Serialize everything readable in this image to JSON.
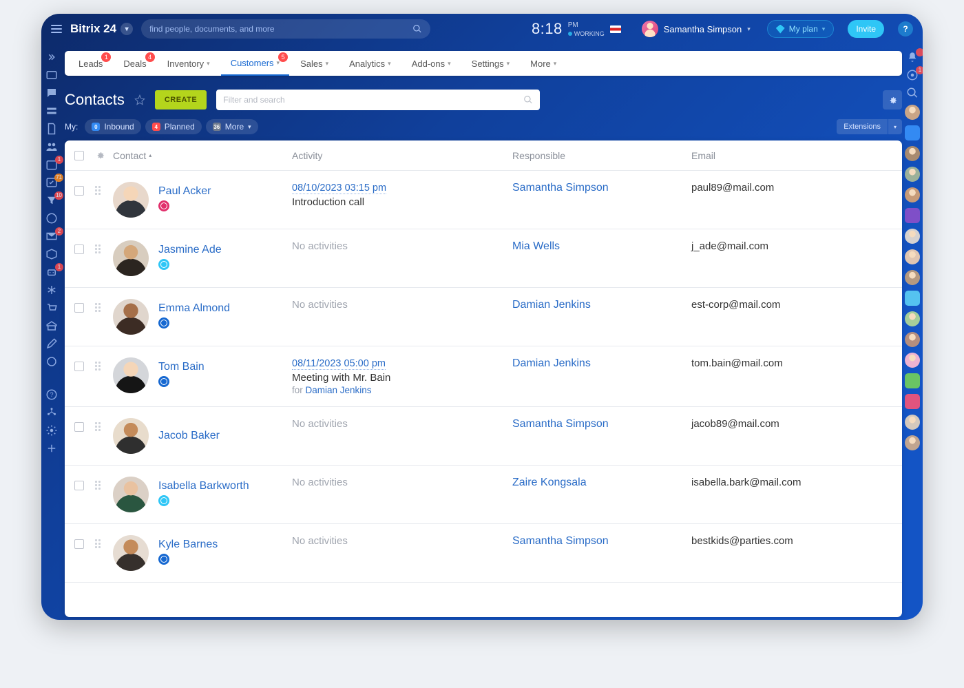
{
  "brand": "Bitrix 24",
  "search_placeholder": "find people, documents, and more",
  "clock": {
    "time": "8:18",
    "ampm": "PM",
    "status": "WORKING"
  },
  "user_name": "Samantha Simpson",
  "plan_label": "My plan",
  "invite_label": "Invite",
  "menu": [
    {
      "label": "Leads",
      "badge": "1"
    },
    {
      "label": "Deals",
      "badge": "4"
    },
    {
      "label": "Inventory"
    },
    {
      "label": "Customers",
      "badge": "5",
      "active": true
    },
    {
      "label": "Sales"
    },
    {
      "label": "Analytics"
    },
    {
      "label": "Add-ons"
    },
    {
      "label": "Settings"
    },
    {
      "label": "More"
    }
  ],
  "page_title": "Contacts",
  "create_label": "CREATE",
  "filter_placeholder": "Filter and search",
  "mybar": {
    "label": "My:",
    "chips": [
      {
        "c": "0",
        "color": "#338af3",
        "label": "Inbound"
      },
      {
        "c": "4",
        "color": "#ff4c4c",
        "label": "Planned"
      },
      {
        "c": "36",
        "color": "#6f7b8e",
        "label": "More"
      }
    ],
    "ext": "Extensions"
  },
  "columns": {
    "contact": "Contact",
    "activity": "Activity",
    "responsible": "Responsible",
    "email": "Email"
  },
  "rows": [
    {
      "photo": "a1",
      "name": "Paul Acker",
      "badge": "#e1306c",
      "date": "08/10/2023 03:15 pm",
      "desc": "Introduction call",
      "resp": "Samantha Simpson",
      "email": "paul89@mail.com"
    },
    {
      "photo": "a2",
      "name": "Jasmine Ade",
      "badge": "#2fc6f6",
      "noact": "No activities",
      "resp": "Mia Wells",
      "email": "j_ade@mail.com"
    },
    {
      "photo": "a3",
      "name": "Emma Almond",
      "badge": "#1668d1",
      "noact": "No activities",
      "resp": "Damian Jenkins",
      "email": "est-corp@mail.com"
    },
    {
      "photo": "a4",
      "name": "Tom Bain",
      "badge": "#1668d1",
      "date": "08/11/2023 05:00 pm",
      "desc": "Meeting with Mr. Bain",
      "for_label": "for",
      "for_person": "Damian Jenkins",
      "resp": "Damian Jenkins",
      "email": "tom.bain@mail.com"
    },
    {
      "photo": "a5",
      "name": "Jacob Baker",
      "noact": "No activities",
      "resp": "Samantha Simpson",
      "email": "jacob89@mail.com"
    },
    {
      "photo": "a6",
      "name": "Isabella Barkworth",
      "badge": "#2fc6f6",
      "noact": "No activities",
      "resp": "Zaire Kongsala",
      "email": "isabella.bark@mail.com"
    },
    {
      "photo": "a7",
      "name": "Kyle Barnes",
      "badge": "#1668d1",
      "noact": "No activities",
      "resp": "Samantha Simpson",
      "email": "bestkids@parties.com"
    }
  ],
  "left_rail": [
    {
      "name": "arrows-icon"
    },
    {
      "name": "window-icon"
    },
    {
      "name": "chat-icon"
    },
    {
      "name": "tray-icon"
    },
    {
      "name": "doc-icon"
    },
    {
      "name": "team-icon"
    },
    {
      "name": "calendar-icon",
      "badge": "1",
      "color": "#ff4c4c"
    },
    {
      "name": "tasks-icon",
      "badge": "71",
      "color": "#ff8c1a"
    },
    {
      "name": "filter-icon",
      "badge": "10",
      "color": "#ff4c4c"
    },
    {
      "name": "gauge-icon"
    },
    {
      "name": "mail-icon",
      "badge": "2",
      "color": "#ff4c4c"
    },
    {
      "name": "box-icon"
    },
    {
      "name": "robot-icon",
      "badge": "1",
      "color": "#ff4c4c"
    },
    {
      "name": "asterisk-icon"
    },
    {
      "name": "cart-icon"
    },
    {
      "name": "bank-icon"
    },
    {
      "name": "pencil-icon"
    },
    {
      "name": "circle-icon"
    },
    {
      "name": "help-icon"
    },
    {
      "name": "tree-icon"
    },
    {
      "name": "settings-icon"
    },
    {
      "name": "plus-icon"
    }
  ],
  "right_rail": [
    {
      "type": "icon",
      "name": "bell-icon",
      "badge": " "
    },
    {
      "type": "icon",
      "name": "copilot-icon",
      "badge": "1"
    },
    {
      "type": "icon",
      "name": "search-icon"
    },
    {
      "type": "avatar",
      "bg": "#c9a587"
    },
    {
      "type": "square",
      "bg": "#338af3"
    },
    {
      "type": "avatar",
      "bg": "#a88b70"
    },
    {
      "type": "avatar",
      "bg": "#9cb19a"
    },
    {
      "type": "avatar",
      "bg": "#c79b78"
    },
    {
      "type": "square",
      "bg": "#7f4fc8"
    },
    {
      "type": "avatar",
      "bg": "#d6d2d0"
    },
    {
      "type": "avatar",
      "bg": "#e0c6b2"
    },
    {
      "type": "avatar",
      "bg": "#b59980"
    },
    {
      "type": "square",
      "bg": "#55c3f0"
    },
    {
      "type": "avatar",
      "bg": "#a5ce9a"
    },
    {
      "type": "avatar",
      "bg": "#b58e7e"
    },
    {
      "type": "avatar",
      "bg": "#efb3d1"
    },
    {
      "type": "square",
      "bg": "#6ac463"
    },
    {
      "type": "square",
      "bg": "#e1547e"
    },
    {
      "type": "avatar",
      "bg": "#d4c9bd"
    },
    {
      "type": "avatar",
      "bg": "#c0a590"
    }
  ]
}
